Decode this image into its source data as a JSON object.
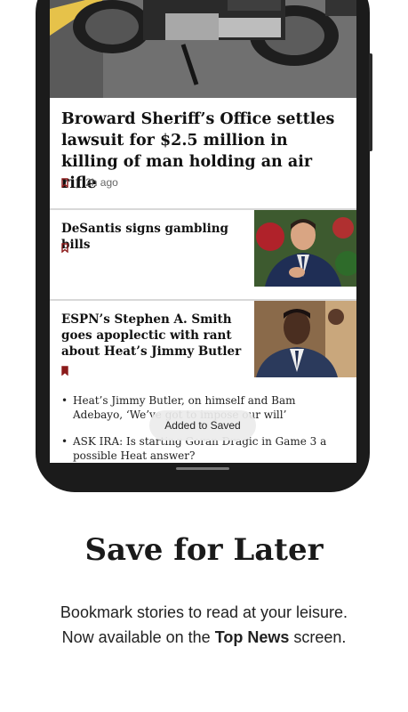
{
  "story1": {
    "headline": "Broward Sheriff’s Office settles lawsuit for $2.5 million in killing of man holding an air rifle",
    "separator": "|",
    "time": "2h ago"
  },
  "story2": {
    "headline": "DeSantis signs gambling bills"
  },
  "story3": {
    "headline": "ESPN’s Stephen A. Smith goes apoplectic with rant about Heat’s Jimmy Butler",
    "related": [
      "Heat’s Jimmy Butler, on himself and Bam Adebayo, ‘We’ve got to impose our will’",
      "ASK IRA: Is starting Goran Dragic in Game 3 a possible Heat answer?"
    ]
  },
  "toast": {
    "text": "Added to Saved"
  },
  "promo": {
    "title": "Save for Later",
    "line1": "Bookmark stories to read at your leisure.",
    "line2_prefix": "Now available on the",
    "line2_bold": "Top News",
    "line2_suffix": "screen."
  },
  "colors": {
    "bookmark": "#8b1a1a"
  },
  "icons": {
    "bookmark_outline": "bookmark-outline-icon",
    "bookmark_filled": "bookmark-filled-icon"
  }
}
